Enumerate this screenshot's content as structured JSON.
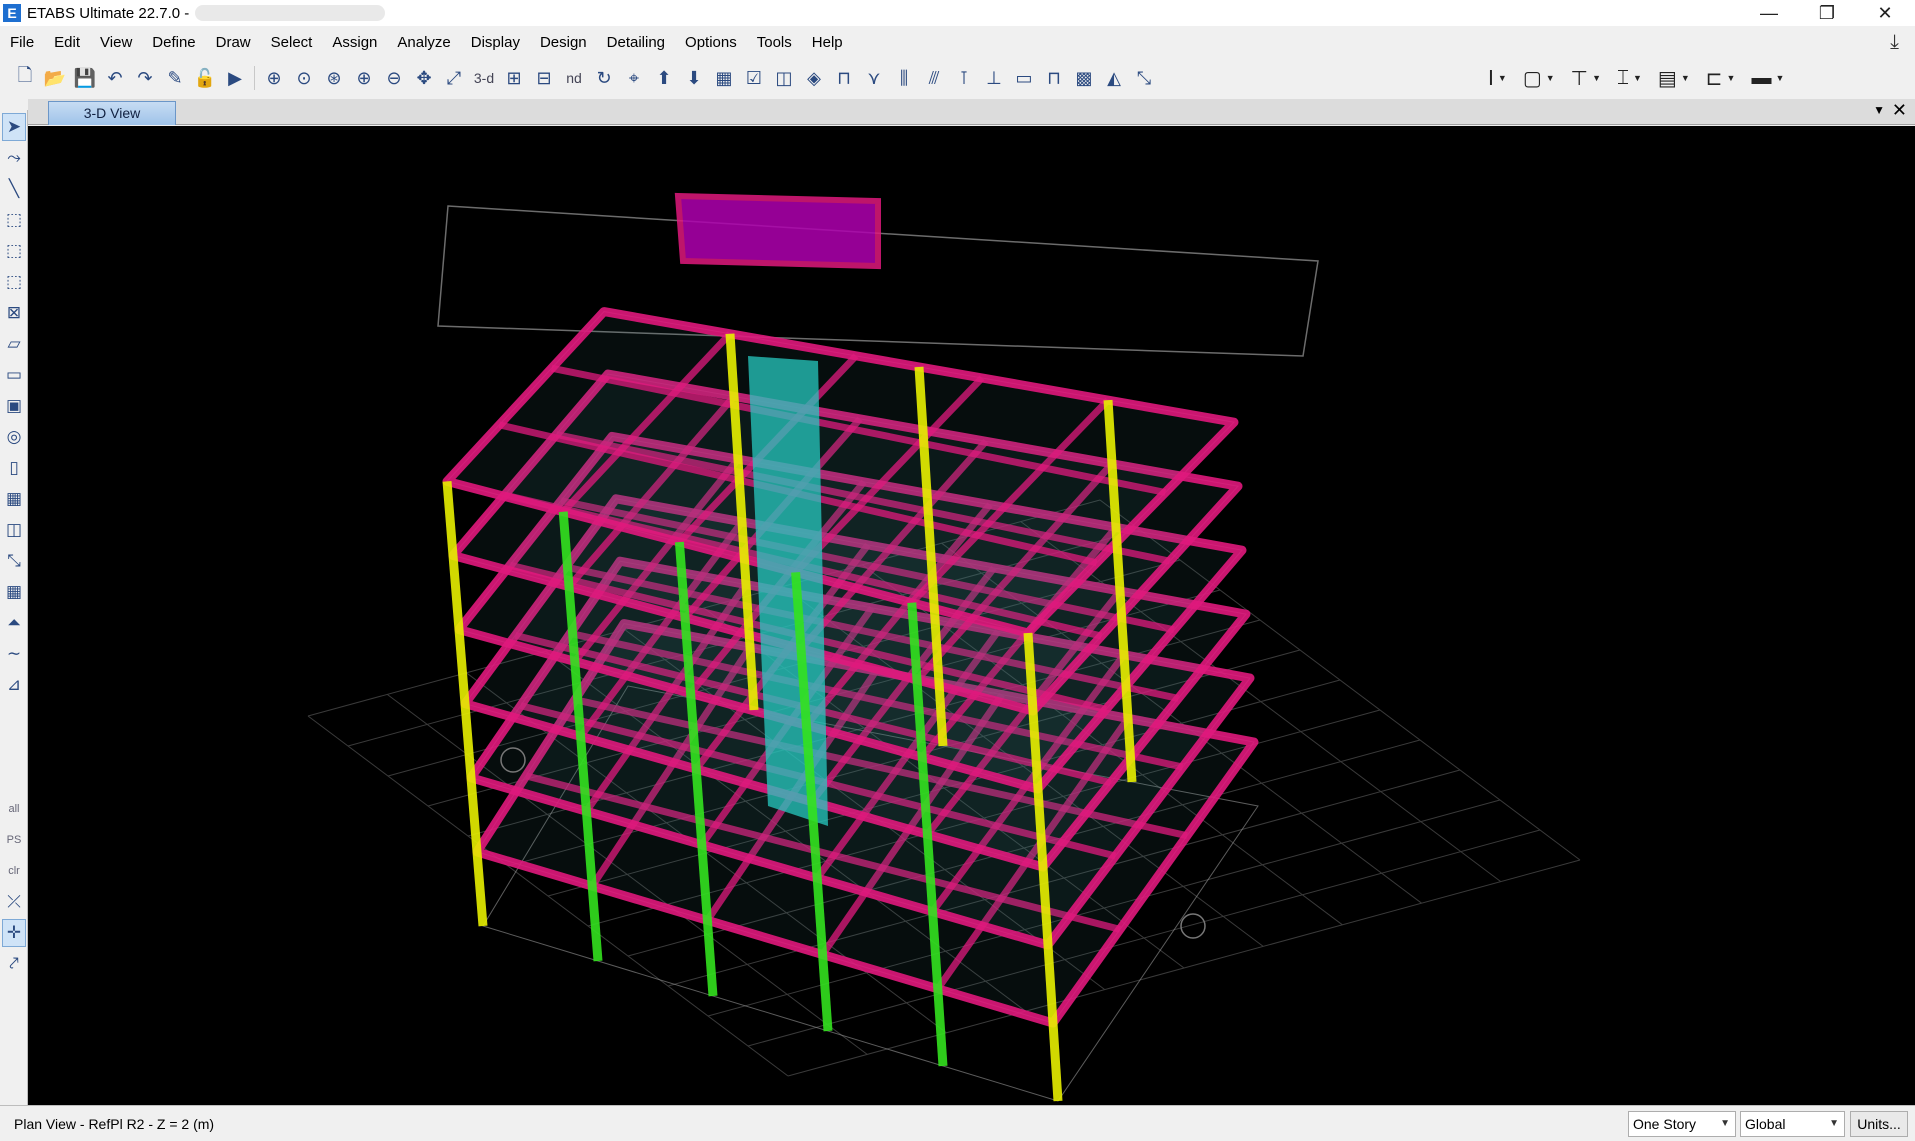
{
  "window": {
    "icon_letter": "E",
    "title": "ETABS Ultimate 22.7.0 -",
    "minimize": "—",
    "restore": "❐",
    "close": "✕"
  },
  "menu": [
    "File",
    "Edit",
    "View",
    "Define",
    "Draw",
    "Select",
    "Assign",
    "Analyze",
    "Display",
    "Design",
    "Detailing",
    "Options",
    "Tools",
    "Help"
  ],
  "toolbar": {
    "view_3d_label": "3-d",
    "nd_label": "nd"
  },
  "left_toolbar": {
    "all_label": "all",
    "ps_label": "PS",
    "clr_label": "clr"
  },
  "tabs": {
    "active_tab": "3-D View"
  },
  "status": {
    "text": "Plan View - RefPl R2 - Z = 2 (m)",
    "story_select": "One Story",
    "coord_select": "Global",
    "units_button": "Units..."
  },
  "colors": {
    "beams": "#e0197d",
    "columns_green": "#33e21f",
    "columns_yellow": "#e8f000",
    "core_cyan": "#27c9c0",
    "slab_magenta": "#b000b0",
    "wireframe": "#9a9a9a",
    "background": "#000000"
  }
}
